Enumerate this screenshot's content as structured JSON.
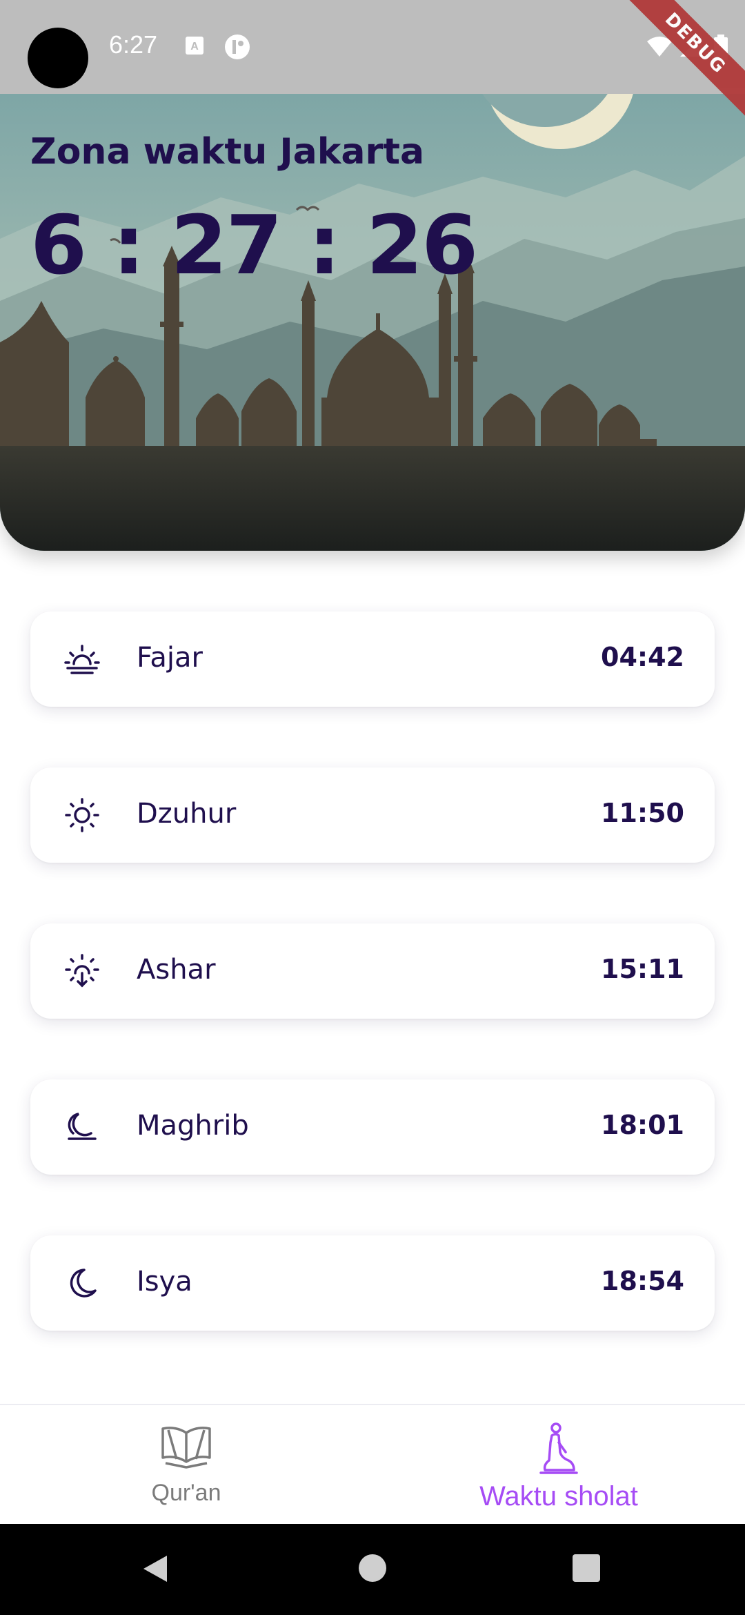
{
  "status_bar": {
    "time": "6:27",
    "icons": [
      "keyboard-a-icon",
      "notification-icon",
      "wifi-icon",
      "signal-icon",
      "battery-icon"
    ],
    "debug_label": "DEBUG"
  },
  "hero": {
    "timezone_label": "Zona waktu Jakarta",
    "clock": "6 : 27 : 26"
  },
  "prayers": [
    {
      "name": "Fajar",
      "time": "04:42",
      "icon": "sunrise-icon"
    },
    {
      "name": "Dzuhur",
      "time": "11:50",
      "icon": "sun-icon"
    },
    {
      "name": "Ashar",
      "time": "15:11",
      "icon": "sun-down-icon"
    },
    {
      "name": "Maghrib",
      "time": "18:01",
      "icon": "moonrise-icon"
    },
    {
      "name": "Isya",
      "time": "18:54",
      "icon": "moon-icon"
    }
  ],
  "bottom_nav": {
    "items": [
      {
        "label": "Qur'an",
        "icon": "quran-book-icon",
        "active": false
      },
      {
        "label": "Waktu sholat",
        "icon": "prayer-person-icon",
        "active": true
      }
    ]
  },
  "colors": {
    "primary_text": "#1f0f4d",
    "accent": "#a64cf5",
    "inactive": "#7b7b7b"
  }
}
